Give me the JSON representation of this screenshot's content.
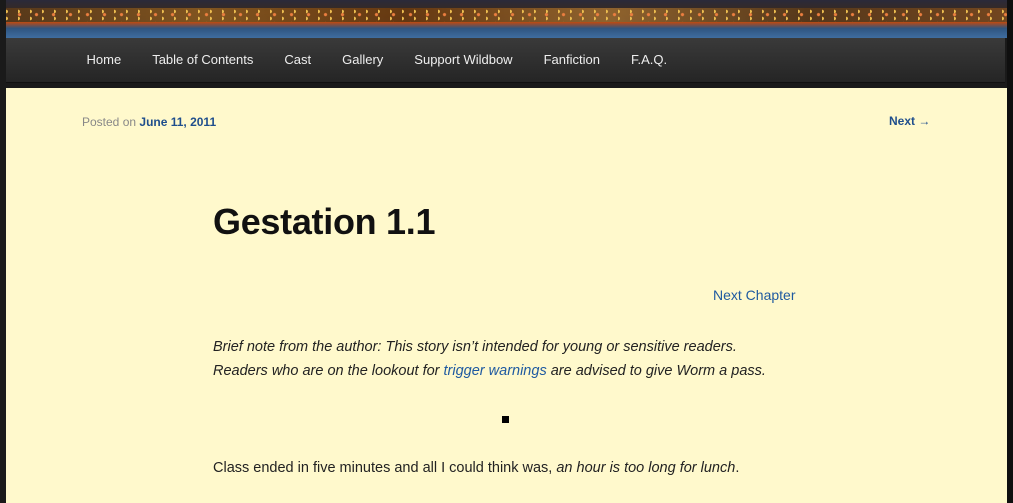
{
  "nav": {
    "items": [
      "Home",
      "Table of Contents",
      "Cast",
      "Gallery",
      "Support Wildbow",
      "Fanfiction",
      "F.A.Q."
    ]
  },
  "post": {
    "posted_prefix": "Posted on",
    "date": "June 11, 2011",
    "next_label": "Next →",
    "title": "Gestation 1.1",
    "next_chapter": "Next Chapter",
    "note_line1": "Brief note from the author:  This story isn’t intended for young or sensitive readers.",
    "note_line2_pre": " Readers who are on the lookout for ",
    "note_link": "trigger warnings",
    "note_line2_post": " are advised to give Worm a pass.",
    "separator": "■",
    "para_plain": "Class ended in five minutes and all I could think was, ",
    "para_italic": "an hour is too long for lunch",
    "para_end": "."
  }
}
